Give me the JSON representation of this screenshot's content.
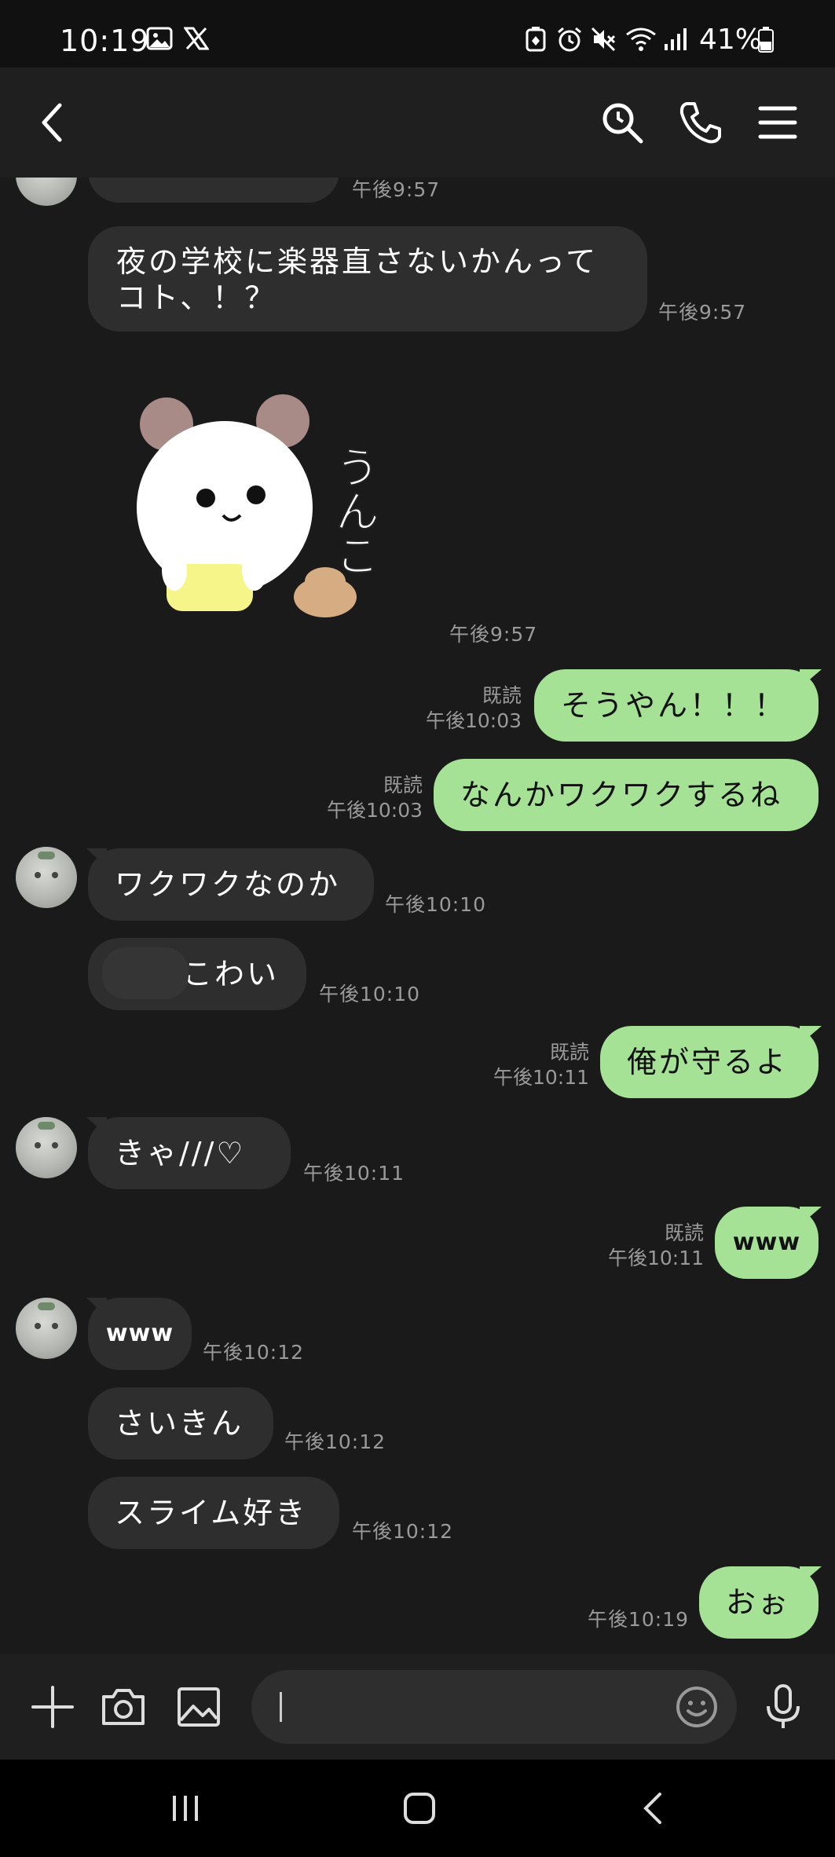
{
  "status_bar": {
    "time": "10:19",
    "battery": "41%",
    "icons": [
      "gallery-icon",
      "x-icon",
      "battery-saver-icon",
      "alarm-icon",
      "mute-icon",
      "wifi-icon",
      "signal-icon",
      "battery-icon"
    ]
  },
  "header": {
    "icons": [
      "back-icon",
      "search-icon",
      "call-icon",
      "menu-icon"
    ]
  },
  "messages": [
    {
      "side": "in",
      "text": "",
      "time": "午後9:57"
    },
    {
      "side": "in",
      "text": "夜の学校に楽器直さないかんってコト、！？",
      "time": "午後9:57"
    },
    {
      "side": "in",
      "type": "sticker",
      "sticker_text": "うんこ",
      "time": "午後9:57"
    },
    {
      "side": "out",
      "text": "そうやん！！！",
      "read": "既読",
      "time": "午後10:03"
    },
    {
      "side": "out",
      "text": "なんかワクワクするね",
      "read": "既読",
      "time": "午後10:03"
    },
    {
      "side": "in",
      "text": "ワクワクなのか",
      "time": "午後10:10"
    },
    {
      "side": "in",
      "text": "こわい",
      "time": "午後10:10"
    },
    {
      "side": "out",
      "text": "俺が守るよ",
      "read": "既読",
      "time": "午後10:11"
    },
    {
      "side": "in",
      "text": "きゃ///♡",
      "time": "午後10:11"
    },
    {
      "side": "out",
      "text": "www",
      "read": "既読",
      "time": "午後10:11"
    },
    {
      "side": "in",
      "text": "www",
      "time": "午後10:12"
    },
    {
      "side": "in",
      "text": "さいきん",
      "time": "午後10:12"
    },
    {
      "side": "in",
      "text": "スライム好き",
      "time": "午後10:12"
    },
    {
      "side": "out",
      "text": "おぉ",
      "time": "午後10:19"
    }
  ],
  "input_bar": {
    "placeholder": "",
    "icons": [
      "plus-icon",
      "camera-icon",
      "image-icon",
      "emoji-icon",
      "mic-icon"
    ]
  },
  "colors": {
    "background": "#1a1a1a",
    "incoming_bubble": "#2e2e2e",
    "outgoing_bubble": "#a5e295",
    "timestamp": "#9a9a9a"
  }
}
